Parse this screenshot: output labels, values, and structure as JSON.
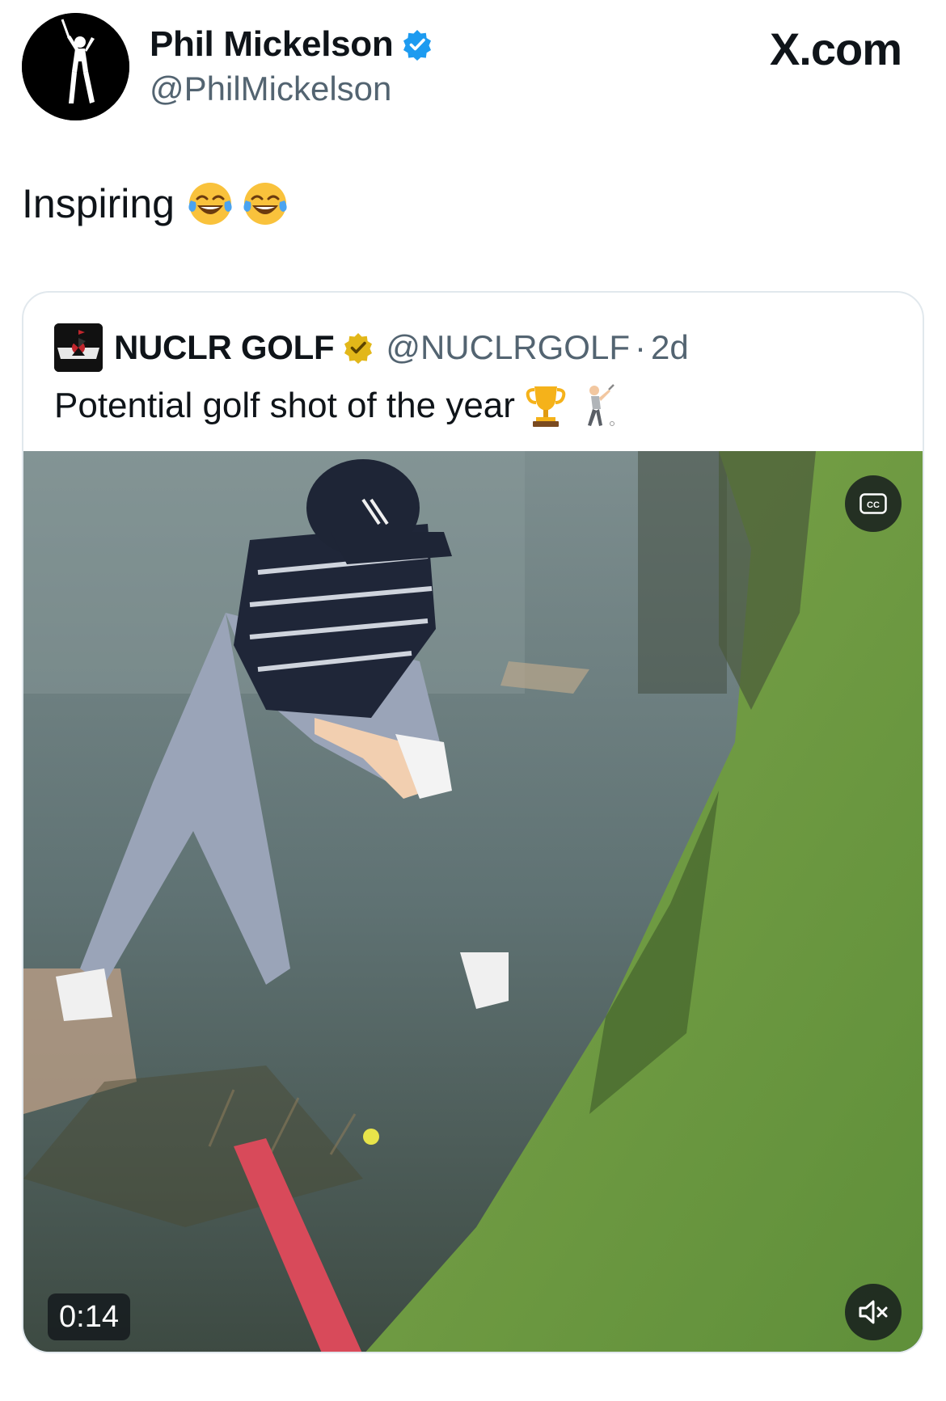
{
  "post": {
    "author_name": "Phil Mickelson",
    "author_handle": "@PhilMickelson",
    "site_mark": "X.com",
    "text": "Inspiring",
    "emojis": [
      "face-with-tears-of-joy",
      "face-with-tears-of-joy"
    ]
  },
  "quote": {
    "author_name": "NUCLR GOLF",
    "author_handle": "@NUCLRGOLF",
    "separator": "·",
    "time_ago": "2d",
    "text": "Potential golf shot of the year",
    "emojis": [
      "trophy",
      "person-golfing"
    ],
    "video": {
      "duration": "0:14",
      "cc_label": "CC",
      "muted": true
    }
  },
  "colors": {
    "verified_blue": "#1d9bf0",
    "verified_gold": "#e2b719",
    "text_primary": "#0f1419",
    "text_secondary": "#536471",
    "card_border": "#e1e8ed"
  }
}
